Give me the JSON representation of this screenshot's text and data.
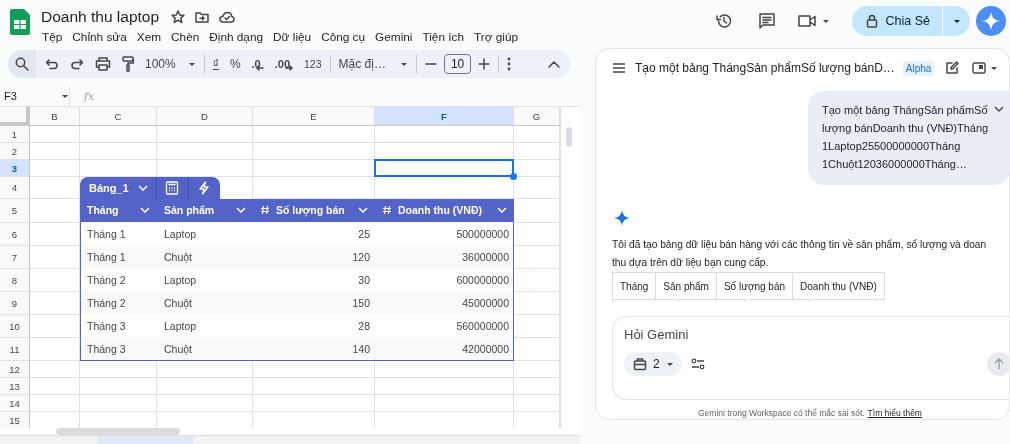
{
  "app": {
    "title": "Doanh thu laptop",
    "menu": [
      "Tệp",
      "Chỉnh sửa",
      "Xem",
      "Chèn",
      "Định dạng",
      "Dữ liệu",
      "Công cụ",
      "Gemini",
      "Tiện ích",
      "Trợ giúp"
    ],
    "share_label": "Chia Sẻ"
  },
  "toolbar": {
    "zoom": "100%",
    "currency": "₫",
    "percent": "%",
    "decrease_decimals": ".0",
    "increase_decimals": ".00",
    "number_format": "123",
    "font": "Mặc đị…",
    "font_size": "10"
  },
  "formula_bar": {
    "cell_ref": "F3",
    "fx": "fx"
  },
  "sheet": {
    "columns": [
      {
        "label": "B",
        "selected": false
      },
      {
        "label": "C",
        "selected": false
      },
      {
        "label": "D",
        "selected": false
      },
      {
        "label": "E",
        "selected": false
      },
      {
        "label": "F",
        "selected": true
      },
      {
        "label": "G",
        "selected": false
      }
    ],
    "rows": [
      {
        "label": "1",
        "selected": false
      },
      {
        "label": "2",
        "selected": false
      },
      {
        "label": "3",
        "selected": true
      },
      {
        "label": "4",
        "selected": false
      },
      {
        "label": "5",
        "selected": false
      },
      {
        "label": "6",
        "selected": false
      },
      {
        "label": "7",
        "selected": false
      },
      {
        "label": "8",
        "selected": false
      },
      {
        "label": "9",
        "selected": false
      },
      {
        "label": "10",
        "selected": false
      },
      {
        "label": "11",
        "selected": false
      },
      {
        "label": "12",
        "selected": false
      },
      {
        "label": "13",
        "selected": false
      },
      {
        "label": "14",
        "selected": false
      },
      {
        "label": "15",
        "selected": false
      }
    ]
  },
  "table": {
    "name": "Bảng_1",
    "columns": [
      {
        "label": "Tháng",
        "kind": "text"
      },
      {
        "label": "Sản phẩm",
        "kind": "text"
      },
      {
        "label": "Số lượng bán",
        "kind": "number"
      },
      {
        "label": "Doanh thu (VNĐ)",
        "kind": "number"
      }
    ],
    "rows": [
      [
        "Tháng 1",
        "Laptop",
        "25",
        "500000000"
      ],
      [
        "Tháng 1",
        "Chuột",
        "120",
        "36000000"
      ],
      [
        "Tháng 2",
        "Laptop",
        "30",
        "600000000"
      ],
      [
        "Tháng 2",
        "Chuột",
        "150",
        "45000000"
      ],
      [
        "Tháng 3",
        "Laptop",
        "28",
        "560000000"
      ],
      [
        "Tháng 3",
        "Chuột",
        "140",
        "42000000"
      ]
    ]
  },
  "gemini_panel": {
    "title": "Tạo một bảng ThángSản phẩmSố lượng bánD…",
    "badge": "Alpha",
    "prompt_lines": [
      "Tạo một bảng ThángSản phẩmSố",
      "lượng bánDoanh thu (VNĐ)Tháng",
      "1Laptop25500000000Tháng",
      "1Chuột12036000000Tháng…"
    ],
    "response_lines": [
      "Tôi đã tạo bảng dữ liệu bán hàng với các thông tin về sản phẩm, số lượng và doan",
      "thu dựa trên dữ liệu bạn cung cấp."
    ],
    "response_table_columns": [
      "Tháng",
      "Sản phẩm",
      "Số lượng bán",
      "Doanh thu (VNĐ)"
    ],
    "input": {
      "placeholder": "Hỏi Gemini",
      "chip_count": "2"
    },
    "disclaimer": "Gemini trong Workspace có thể mắc sai sót.",
    "learn_more": "Tìm hiểu thêm"
  }
}
